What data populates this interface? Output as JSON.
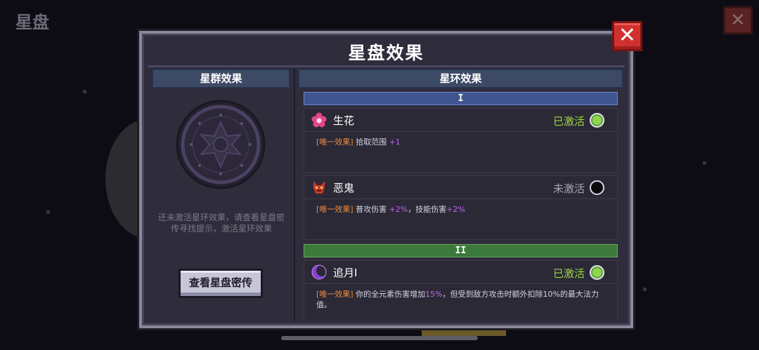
{
  "background": {
    "title": "星盘"
  },
  "modal": {
    "title": "星盘效果",
    "close_label": "✕"
  },
  "left_panel": {
    "header": "星群效果",
    "hint": "还未激活星环效果，请查看星盘密传寻找提示，激活星环效果",
    "button_label": "查看星盘密传"
  },
  "right_panel": {
    "header": "星环效果",
    "tiers": [
      {
        "label": "I",
        "effects": [
          {
            "name": "生花",
            "icon": "flower-icon",
            "status": "已激活",
            "active": true,
            "desc_tag": "[唯一效果]",
            "desc_parts": [
              "拾取范围 ",
              "+1"
            ]
          },
          {
            "name": "恶鬼",
            "icon": "demon-icon",
            "status": "未激活",
            "active": false,
            "desc_tag": "[唯一效果]",
            "desc_parts": [
              "普攻伤害 ",
              "+2%",
              "，技能伤害",
              "+2%"
            ]
          }
        ]
      },
      {
        "label": "II",
        "effects": [
          {
            "name": "追月Ⅰ",
            "icon": "crescent-moon-icon",
            "status": "已激活",
            "active": true,
            "desc_tag": "[唯一效果]",
            "desc_parts": [
              "你的全元素伤害增加",
              "15%",
              "，但受到敌方攻击时额外扣除10%的最大法力值。"
            ]
          }
        ]
      }
    ]
  },
  "colors": {
    "active_status": "#9ad846",
    "tag": "#ef8a3a",
    "highlight": "#c066ef",
    "tier1": "#3f5590",
    "tier2": "#3c7a3c",
    "close": "#d0312f"
  }
}
